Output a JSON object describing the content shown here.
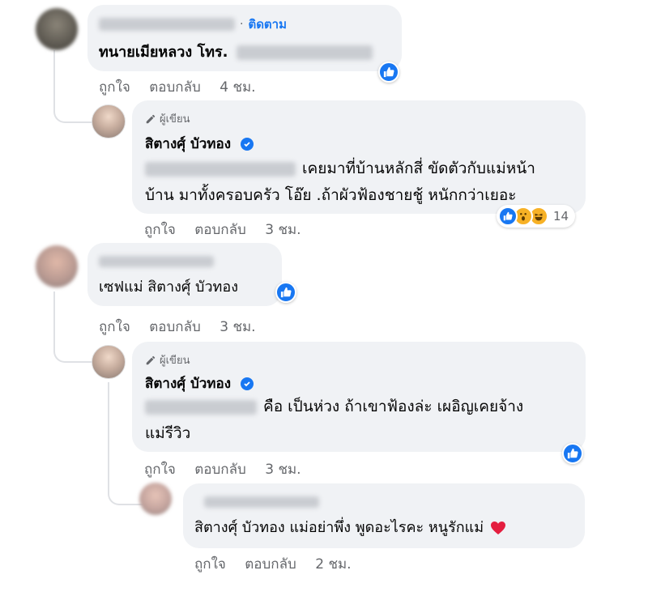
{
  "comments": [
    {
      "follow_label": "ติดตาม",
      "text_prefix": "ทนายเมียหลวง โทร.",
      "meta": {
        "like": "ถูกใจ",
        "reply": "ตอบกลับ",
        "time": "4 ชม."
      }
    },
    {
      "author_tag": "ผู้เขียน",
      "name": "สิตางศุ์ บัวทอง",
      "line1": "เคยมาที่บ้านหลักสี่ ขัดตัวกับแม่หน้า",
      "line2": "บ้าน มาทั้งครอบครัว โอ๊ย .ถ้าผัวฟ้องชายชู้ หนักกว่าเยอะ",
      "reaction_count": "14",
      "meta": {
        "like": "ถูกใจ",
        "reply": "ตอบกลับ",
        "time": "3 ชม."
      }
    },
    {
      "text": "เซฟแม่ สิตางศุ์ บัวทอง",
      "meta": {
        "like": "ถูกใจ",
        "reply": "ตอบกลับ",
        "time": "3 ชม."
      }
    },
    {
      "author_tag": "ผู้เขียน",
      "name": "สิตางศุ์ บัวทอง",
      "line1": "คือ เป็นห่วง ถ้าเขาฟ้องล่ะ เผอิญเคยจ้าง",
      "line2": "แม่รีวิว",
      "meta": {
        "like": "ถูกใจ",
        "reply": "ตอบกลับ",
        "time": "3 ชม."
      }
    },
    {
      "text": "สิตางศุ์ บัวทอง แม่อย่าพึ่ง พูดอะไรคะ หนูรักแม่",
      "meta": {
        "like": "ถูกใจ",
        "reply": "ตอบกลับ",
        "time": "2 ชม."
      }
    }
  ],
  "colors": {
    "bubble": "#f0f2f5",
    "meta": "#65676b",
    "like_blue": "#1877f2",
    "heart": "#e41e3f"
  },
  "icons": [
    "like-icon",
    "haha-icon",
    "wow-icon",
    "pencil-icon",
    "verified-badge-icon",
    "heart-icon"
  ]
}
